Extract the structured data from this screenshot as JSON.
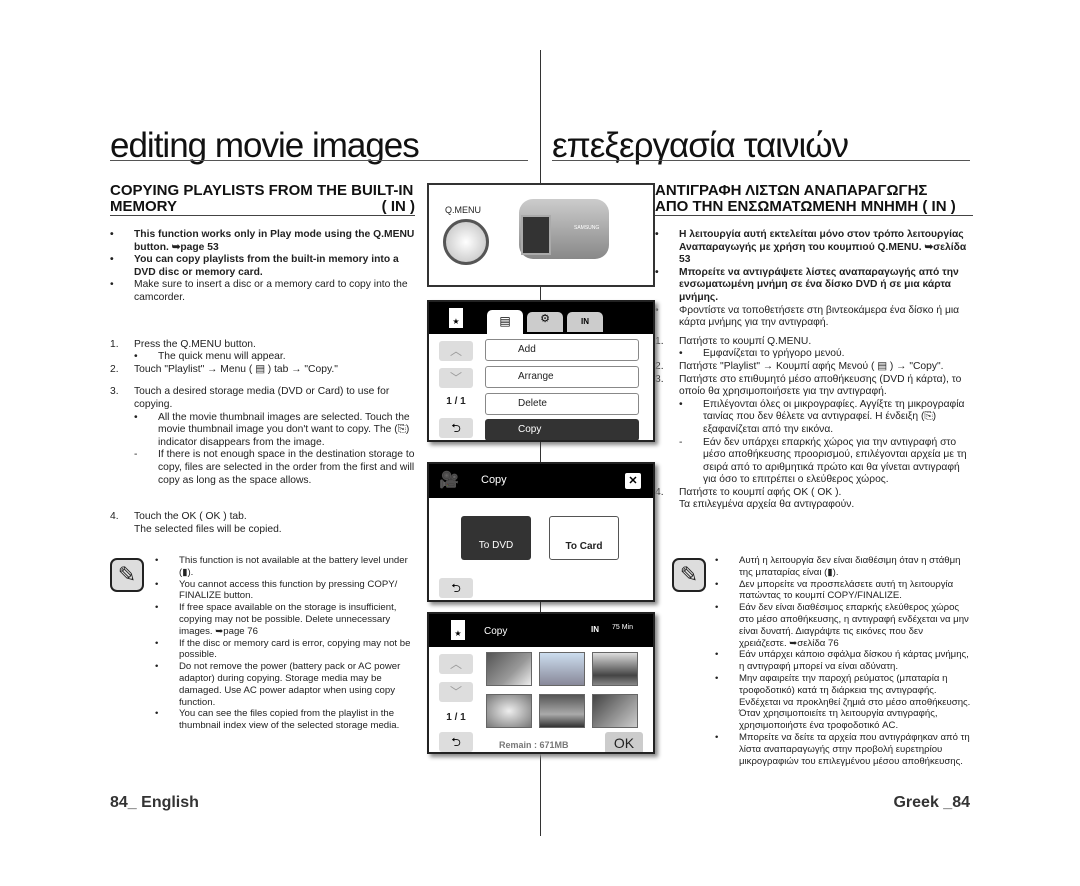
{
  "titles": {
    "left": "editing movie images",
    "right": "επεξεργασία ταινιών"
  },
  "left": {
    "heading1": "COPYING PLAYLISTS FROM THE BUILT-IN",
    "heading2": "MEMORY",
    "heading_icon": "( IN )",
    "bullets": [
      "This function works only in Play mode using the Q.MENU button. ➥page 53",
      "You can copy playlists from the built-in memory into a DVD disc or memory card.",
      "Make sure to insert a disc or a memory card to copy into the camcorder."
    ],
    "step1": "Press the Q.MENU button.",
    "step1_sub": "The quick menu will appear.",
    "step2": "Touch \"Playlist\" → Menu ( ▤ ) tab → \"Copy.\"",
    "step3": "Touch a desired storage media (DVD or Card) to use for copying.",
    "step3_sub1": "All the movie thumbnail images are selected. Touch the movie thumbnail image you don't want to copy. The (⎘) indicator disappears from the image.",
    "step3_sub2": "If there is not enough space in the destination storage to copy, files are selected in the order from the first and will copy as long as the space allows.",
    "step4": "Touch the OK ( OK ) tab.",
    "step4_b": "The selected files will be copied.",
    "notes": [
      "This function is not available at the battery level under (▮).",
      "You cannot access this function by pressing COPY/ FINALIZE button.",
      "If free space available on the storage is insufficient, copying may not be possible. Delete unnecessary images. ➥page 76",
      "If the disc or memory card is error, copying may not be possible.",
      "Do not remove the power (battery pack or AC power adaptor) during copying. Storage media may be damaged. Use AC power adaptor when using copy function.",
      "You can see the files copied from the playlist in the thumbnail index view of the selected storage media."
    ],
    "footer": "84_ English"
  },
  "right": {
    "heading1": "ΑΝΤΙΓΡΑΦΗ ΛΙΣΤΩΝ ΑΝΑΠΑΡΑΓΩΓΗΣ",
    "heading2": "ΑΠΟ ΤΗΝ ΕΝΣΩΜΑΤΩΜΕΝΗ ΜΝΗΜΗ",
    "heading_icon": "( IN )",
    "bullets": [
      "Η λειτουργία αυτή εκτελείται μόνο στον τρόπο λειτουργίας Αναπαραγωγής με χρήση του κουμπιού Q.MENU. ➥σελίδα 53",
      "Μπορείτε να αντιγράψετε λίστες αναπαραγωγής από την ενσωματωμένη μνήμη σε ένα δίσκο DVD ή σε μια κάρτα μνήμης.",
      "Φροντίστε να τοποθετήσετε στη βιντεοκάμερα ένα δίσκο ή μια κάρτα μνήμης για την αντιγραφή."
    ],
    "step1": "Πατήστε το κουμπί Q.MENU.",
    "step1_sub": "Εμφανίζεται το γρήγορο μενού.",
    "step2": "Πατήστε \"Playlist\" → Κουμπί αφής Μενού ( ▤ ) → \"Copy\".",
    "step3": "Πατήστε στο επιθυμητό μέσο αποθήκευσης (DVD ή κάρτα), το οποίο θα χρησιμοποιήσετε για την αντιγραφή.",
    "step3_sub1": "Επιλέγονται όλες οι μικρογραφίες. Αγγίξτε τη μικρογραφία ταινίας που δεν θέλετε να αντιγραφεί. Η ένδειξη (⎘) εξαφανίζεται από την εικόνα.",
    "step3_sub2": "Εάν δεν υπάρχει επαρκής χώρος για την αντιγραφή στο μέσο αποθήκευσης προορισμού, επιλέγονται αρχεία με τη σειρά από το αριθμητικά πρώτο και θα γίνεται αντιγραφή για όσο το επιτρέπει ο ελεύθερος χώρος.",
    "step4": "Πατήστε το κουμπί αφής OK ( OK ).",
    "step4_b": "Τα επιλεγμένα αρχεία θα αντιγραφούν.",
    "notes": [
      "Αυτή η λειτουργία δεν είναι διαθέσιμη όταν η στάθμη της μπαταρίας είναι (▮).",
      "Δεν μπορείτε να προσπελάσετε αυτή τη λειτουργία πατώντας το κουμπί COPY/FINALIZE.",
      "Εάν δεν είναι διαθέσιμος επαρκής ελεύθερος χώρος στο μέσο αποθήκευσης, η αντιγραφή ενδέχεται να μην είναι δυνατή. Διαγράψτε τις εικόνες που δεν χρειάζεστε. ➥σελίδα 76",
      "Εάν υπάρχει κάποιο σφάλμα δίσκου ή κάρτας μνήμης, η αντιγραφή μπορεί να είναι αδύνατη.",
      "Μην αφαιρείτε την παροχή ρεύματος (μπαταρία η τροφοδοτικό) κατά τη διάρκεια της αντιγραφής. Ενδέχεται να προκληθεί ζημιά στο μέσο αποθήκευσης. Όταν χρησιμοποιείτε τη λειτουργία αντιγραφής, χρησιμοποιήστε ένα τροφοδοτικό AC.",
      "Μπορείτε να δείτε τα αρχεία που αντιγράφηκαν από τη λίστα αναπαραγωγής στην προβολή ευρετηρίου μικρογραφιών του επιλεγμένου μέσου αποθήκευσης."
    ],
    "footer": "Greek _84"
  },
  "camcorder": {
    "button_label": "Q.MENU",
    "brand": "SAMSUNG"
  },
  "screen1": {
    "items": [
      "Add",
      "Arrange",
      "Delete",
      "Copy"
    ],
    "page": "1 / 1",
    "selected": "Copy"
  },
  "screen2": {
    "title": "Copy",
    "options": [
      "To DVD",
      "To Card"
    ],
    "selected": "To DVD"
  },
  "screen3": {
    "title": "Copy",
    "storage": "IN",
    "battery": "75 Min",
    "page": "1 / 1",
    "remain": "Remain : 671MB",
    "ok": "OK"
  }
}
